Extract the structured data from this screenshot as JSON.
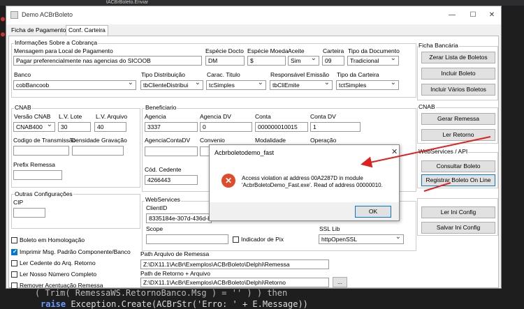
{
  "ide": {
    "tab_label": "tACBrBoleto.Enviar",
    "code_line1": "( Trim( RemessaWS.RetornoBanco.Msg ) = '' ) ) then",
    "code_line2_kw": "raise",
    "code_line2": " Exception.Create(ACBrStr('Erro: ' + E.Message))"
  },
  "window": {
    "title": "Demo ACBrBoleto",
    "min": "—",
    "max": "☐",
    "close": "✕"
  },
  "tabs": [
    "Ficha de Pagamento",
    "Conf. Carteira"
  ],
  "cobranca": {
    "group": "Informações Sobre a Cobrança",
    "msg_label": "Mensagem para Local de Pagamento",
    "msg_value": "Pagar preferencialmente nas agencias do SICOOB",
    "especie_doc_label": "Espécie Docto",
    "especie_doc_value": "DM",
    "especie_moeda_label": "Espécie Moeda",
    "especie_moeda_value": "$",
    "aceite_label": "Aceite",
    "aceite_value": "Sim",
    "carteira_label": "Carteira",
    "carteira_value": "09",
    "tipo_doc_label": "Tipo da Documento",
    "tipo_doc_value": "Tradicional",
    "banco_label": "Banco",
    "banco_value": "cobBancoob",
    "tipo_dist_label": "Tipo Distribuição",
    "tipo_dist_value": "tbClienteDistribui",
    "carac_label": "Carac. Titulo",
    "carac_value": "tcSimples",
    "resp_label": "Responsável Emissão",
    "resp_value": "tbCliEmite",
    "tipo_cart_label": "Tipo da Carteira",
    "tipo_cart_value": "tctSimples"
  },
  "cnab": {
    "group": "CNAB",
    "versao_label": "Versão CNAB",
    "versao_value": "CNAB400",
    "lote_label": "L.V. Lote",
    "lote_value": "30",
    "arquivo_label": "L.V. Arquivo",
    "arquivo_value": "40",
    "codigo_label": "Codigo de Transmissão",
    "densidade_label": "Densidade Gravação",
    "prefix_label": "Prefix Remessa"
  },
  "outras": {
    "group": "Outras Configurações",
    "cip_label": "CIP"
  },
  "beneficiario": {
    "group": "Beneficiario",
    "agencia_label": "Agencia",
    "agencia_value": "3337",
    "agencia_dv_label": "Agencia DV",
    "agencia_dv_value": "0",
    "conta_label": "Conta",
    "conta_value": "000000010015",
    "conta_dv_label": "Conta DV",
    "conta_dv_value": "1",
    "agencia_conta_dv_label": "AgenciaContaDV",
    "convenio_label": "Convenio",
    "modalidade_label": "Modalidade",
    "operacao_label": "Operação",
    "cedente_label": "Cód. Cedente",
    "cedente_value": "4266443"
  },
  "webservices": {
    "group": "WebServices",
    "clientid_label": "ClientID",
    "clientid_value": "8335184e-307d-436d-827",
    "scope_label": "Scope",
    "pix_label": "Indicador de Pix",
    "ssl_label": "SSL Lib",
    "ssl_value": "httpOpenSSL"
  },
  "checks": [
    {
      "label": "Boleto em Homologação",
      "checked": false
    },
    {
      "label": "Imprimir Msg. Padrão Componente/Banco",
      "checked": true
    },
    {
      "label": "Ler Cedente do Arq. Retorno",
      "checked": false
    },
    {
      "label": "Ler Nosso Número Completo",
      "checked": false
    },
    {
      "label": "Remover Acentuação Remessa",
      "checked": false
    }
  ],
  "paths": {
    "remessa_label": "Path Arquivo de Remessa",
    "remessa_value": "Z:\\DX11.1\\AcBr\\Exemplos\\ACBrBoleto\\Delphi\\Remessa",
    "retorno_label": "Path de Retorno + Arquivo",
    "retorno_value": "Z:\\DX11.1\\AcBr\\Exemplos\\ACBrBoleto\\Delphi\\Retorno",
    "browse": "..."
  },
  "ficha": {
    "group": "Ficha Bancária",
    "buttons": [
      "Zerar Lista de Boletos",
      "Incluir Boleto",
      "Incluir Vários Boletos"
    ]
  },
  "cnab_actions": {
    "group": "CNAB",
    "buttons": [
      "Gerar Remessa",
      "Ler Retorno"
    ]
  },
  "ws_actions": {
    "group": "WebServices / API",
    "buttons": [
      "Consultar Boleto",
      "Registrar Boleto On Line"
    ]
  },
  "ini_actions": {
    "buttons": [
      "Ler Ini Config",
      "Salvar Ini Config"
    ]
  },
  "dialog": {
    "title": "Acbrboletodemo_fast",
    "close": "✕",
    "icon": "✕",
    "message": "Access violation at address 00A2287D in module 'AcbrBoletoDemo_Fast.exe'. Read of address 00000010.",
    "ok": "OK"
  },
  "colors": {
    "accent": "#0078d7",
    "error": "#e04b29",
    "annotation_arrow": "#e0201c"
  }
}
